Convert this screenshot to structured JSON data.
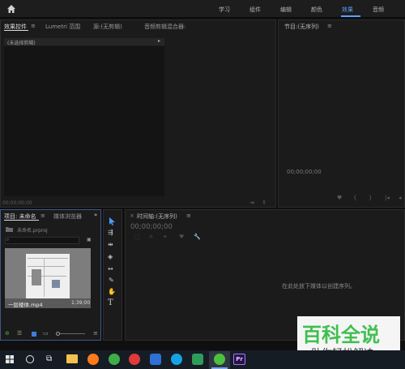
{
  "workspaces": [
    "学习",
    "组件",
    "编辑",
    "颜色",
    "效果",
    "音频"
  ],
  "active_workspace": "效果",
  "fx_panel": {
    "tabs": [
      "效果控件",
      "Lumetri 范围",
      "源:(无剪辑)",
      "音频剪辑混合器:"
    ],
    "no_clip": "(未选择剪辑)",
    "timecode": "00;00;00;00"
  },
  "program_panel": {
    "title": "节目:(无序列)",
    "timecode": "00;00;00;00"
  },
  "project_panel": {
    "tabs": [
      "项目: 未命名",
      "媒体浏览器"
    ],
    "file": "未命名.prproj",
    "clip_name": "一层楼体.mp4",
    "clip_duration": "1;39;00"
  },
  "timeline_panel": {
    "title": "时间轴:(无序列)",
    "timecode": "00;00;00;00",
    "hint": "在此处放下媒体以创建序列。"
  },
  "watermark": {
    "main": "百科全说",
    "sub": "助你轻松解决"
  },
  "colors": {
    "accent": "#5aa0ff",
    "watermark_green": "#3fbf4f",
    "premiere_purple": "#2a1247"
  }
}
